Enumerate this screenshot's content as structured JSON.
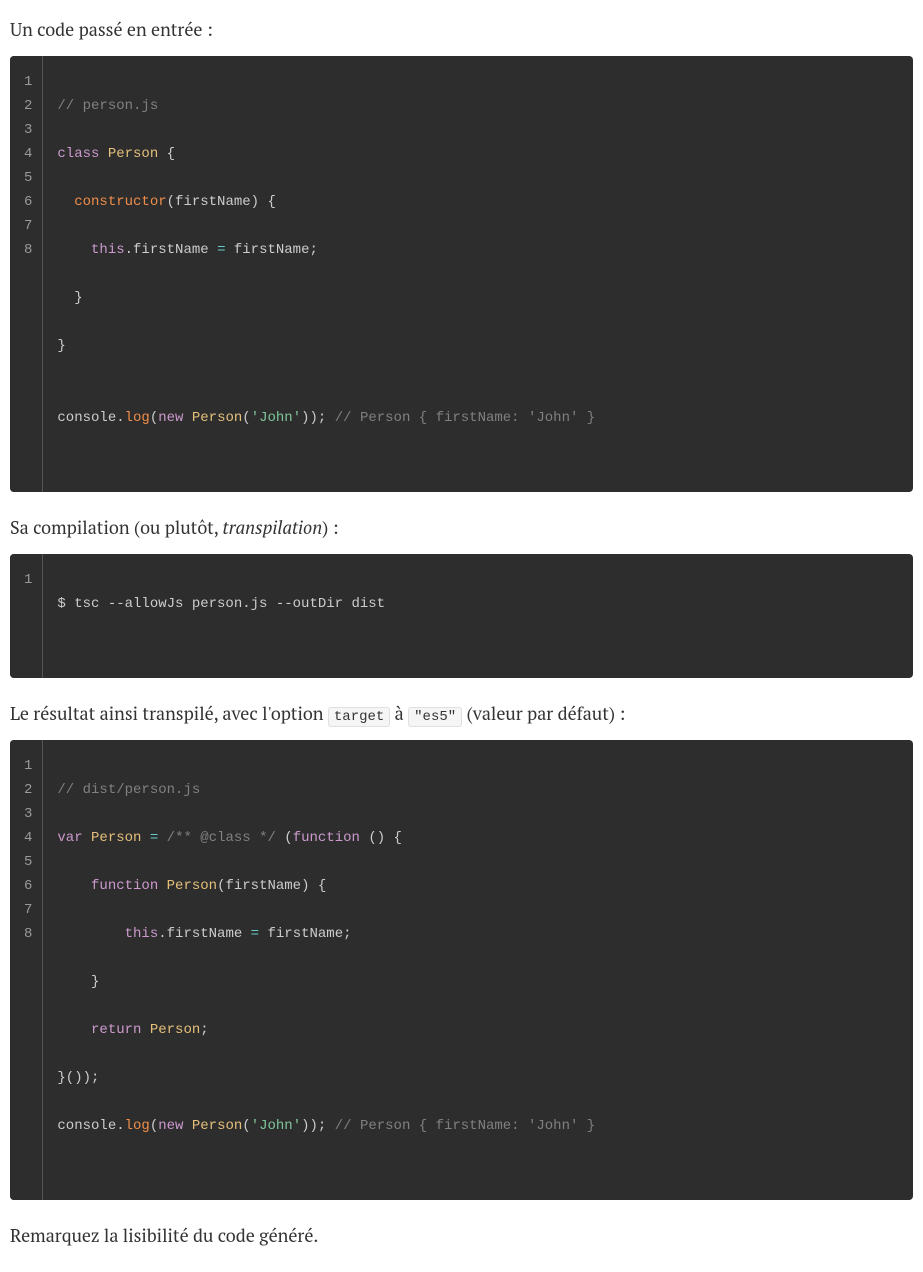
{
  "para1": "Un code passé en entrée :",
  "para2_pre": "Sa compilation (ou plutôt, ",
  "para2_em": "transpilation",
  "para2_post": ") :",
  "para3_pre": "Le résultat ainsi transpilé, avec l'option ",
  "para3_code1": "target",
  "para3_mid": " à ",
  "para3_code2": "\"es5\"",
  "para3_post": " (valeur par défaut) :",
  "para4": "Remarquez la lisibilité du code généré.",
  "code1": {
    "l1": {
      "c1": "// person.js"
    },
    "l2": {
      "kw": "class",
      "sp": " ",
      "cls": "Person",
      "p": " {"
    },
    "l3": {
      "indent": "  ",
      "fn": "constructor",
      "p1": "(",
      "arg": "firstName",
      "p2": ") {"
    },
    "l4": {
      "indent": "    ",
      "this": "this",
      "dot": ".",
      "prop": "firstName",
      "sp": " ",
      "op": "=",
      "sp2": " ",
      "val": "firstName",
      "semi": ";"
    },
    "l5": {
      "indent": "  ",
      "p": "}"
    },
    "l6": {
      "p": "}"
    },
    "l7": {
      "blank": ""
    },
    "l8": {
      "obj": "console",
      "dot": ".",
      "fn": "log",
      "p1": "(",
      "kw": "new",
      "sp": " ",
      "cls": "Person",
      "p2": "(",
      "str": "'John'",
      "p3": "));",
      "sp2": " ",
      "com": "// Person { firstName: 'John' }"
    }
  },
  "code2": {
    "l1": {
      "cmd": "$ tsc --allowJs person.js --outDir dist"
    }
  },
  "code3": {
    "l1": {
      "c1": "// dist/person.js"
    },
    "l2": {
      "kw": "var",
      "sp": " ",
      "cls": "Person",
      "sp2": " ",
      "op": "=",
      "sp3": " ",
      "com": "/** @class */",
      "sp4": " ",
      "p1": "(",
      "kw2": "function",
      "sp5": " ",
      "p2": "() {"
    },
    "l3": {
      "indent": "    ",
      "kw": "function",
      "sp": " ",
      "cls": "Person",
      "p1": "(",
      "arg": "firstName",
      "p2": ") {"
    },
    "l4": {
      "indent": "        ",
      "this": "this",
      "dot": ".",
      "prop": "firstName",
      "sp": " ",
      "op": "=",
      "sp2": " ",
      "val": "firstName",
      "semi": ";"
    },
    "l5": {
      "indent": "    ",
      "p": "}"
    },
    "l6": {
      "indent": "    ",
      "kw": "return",
      "sp": " ",
      "cls": "Person",
      "semi": ";"
    },
    "l7": {
      "p": "}());"
    },
    "l8": {
      "obj": "console",
      "dot": ".",
      "fn": "log",
      "p1": "(",
      "kw": "new",
      "sp": " ",
      "cls": "Person",
      "p2": "(",
      "str": "'John'",
      "p3": "));",
      "sp2": " ",
      "com": "// Person { firstName: 'John' }"
    }
  },
  "ln": {
    "1": "1",
    "2": "2",
    "3": "3",
    "4": "4",
    "5": "5",
    "6": "6",
    "7": "7",
    "8": "8"
  }
}
